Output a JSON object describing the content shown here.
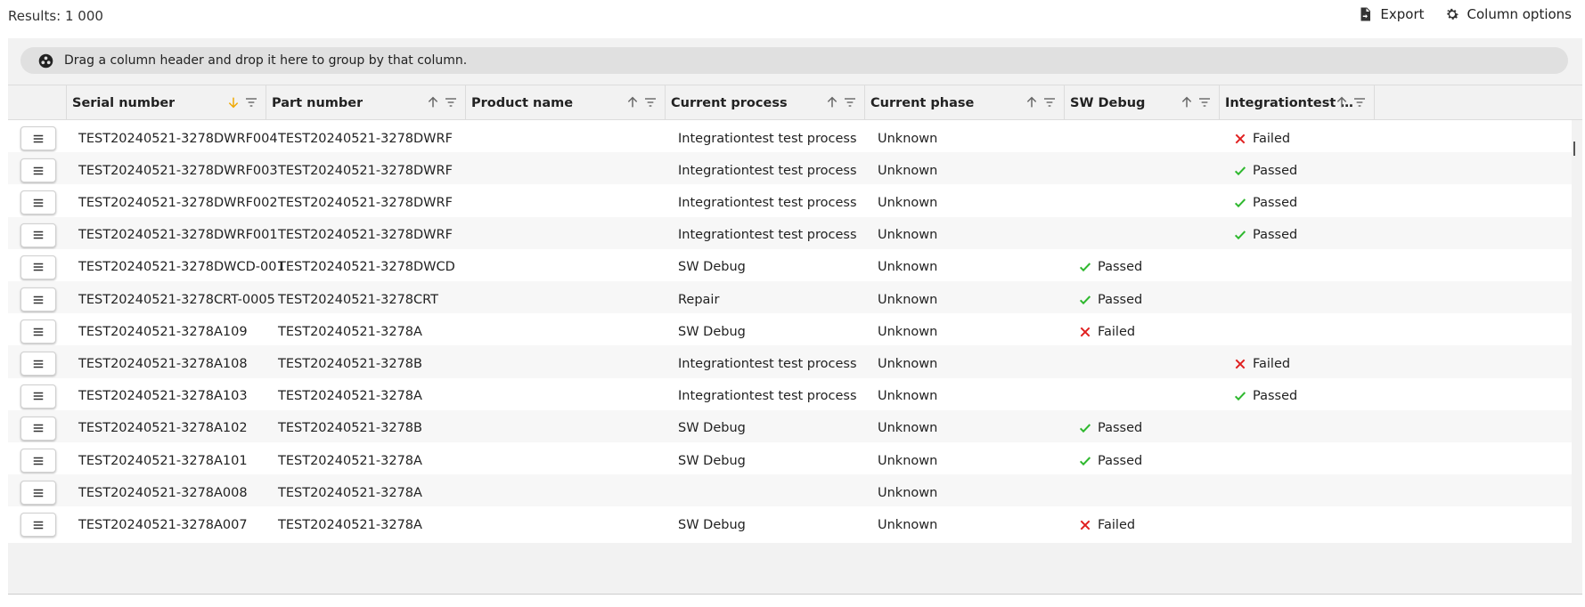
{
  "results_label": "Results: 1 000",
  "actions": {
    "export": "Export",
    "column_options": "Column options"
  },
  "group_bar": {
    "text": "Drag a column header and drop it here to group by that column."
  },
  "columns": [
    {
      "key": "serial",
      "label": "Serial number",
      "sort": "desc-active"
    },
    {
      "key": "part",
      "label": "Part number",
      "sort": "asc"
    },
    {
      "key": "product",
      "label": "Product name",
      "sort": "asc"
    },
    {
      "key": "process",
      "label": "Current process",
      "sort": "asc"
    },
    {
      "key": "phase",
      "label": "Current phase",
      "sort": "asc"
    },
    {
      "key": "swdebug",
      "label": "SW Debug",
      "sort": "asc"
    },
    {
      "key": "integ",
      "label": "Integrationtest te...",
      "sort": "asc"
    }
  ],
  "rows": [
    {
      "serial": "TEST20240521-3278DWRF004",
      "part": "TEST20240521-3278DWRF",
      "product": "",
      "process": "Integrationtest test process",
      "phase": "Unknown",
      "swdebug": "",
      "integ": "Failed"
    },
    {
      "serial": "TEST20240521-3278DWRF003",
      "part": "TEST20240521-3278DWRF",
      "product": "",
      "process": "Integrationtest test process",
      "phase": "Unknown",
      "swdebug": "",
      "integ": "Passed"
    },
    {
      "serial": "TEST20240521-3278DWRF002",
      "part": "TEST20240521-3278DWRF",
      "product": "",
      "process": "Integrationtest test process",
      "phase": "Unknown",
      "swdebug": "",
      "integ": "Passed"
    },
    {
      "serial": "TEST20240521-3278DWRF001",
      "part": "TEST20240521-3278DWRF",
      "product": "",
      "process": "Integrationtest test process",
      "phase": "Unknown",
      "swdebug": "",
      "integ": "Passed"
    },
    {
      "serial": "TEST20240521-3278DWCD-001",
      "part": "TEST20240521-3278DWCD",
      "product": "",
      "process": "SW Debug",
      "phase": "Unknown",
      "swdebug": "Passed",
      "integ": ""
    },
    {
      "serial": "TEST20240521-3278CRT-0005",
      "part": "TEST20240521-3278CRT",
      "product": "",
      "process": "Repair",
      "phase": "Unknown",
      "swdebug": "Passed",
      "integ": ""
    },
    {
      "serial": "TEST20240521-3278A109",
      "part": "TEST20240521-3278A",
      "product": "",
      "process": "SW Debug",
      "phase": "Unknown",
      "swdebug": "Failed",
      "integ": ""
    },
    {
      "serial": "TEST20240521-3278A108",
      "part": "TEST20240521-3278B",
      "product": "",
      "process": "Integrationtest test process",
      "phase": "Unknown",
      "swdebug": "",
      "integ": "Failed"
    },
    {
      "serial": "TEST20240521-3278A103",
      "part": "TEST20240521-3278A",
      "product": "",
      "process": "Integrationtest test process",
      "phase": "Unknown",
      "swdebug": "",
      "integ": "Passed"
    },
    {
      "serial": "TEST20240521-3278A102",
      "part": "TEST20240521-3278B",
      "product": "",
      "process": "SW Debug",
      "phase": "Unknown",
      "swdebug": "Passed",
      "integ": ""
    },
    {
      "serial": "TEST20240521-3278A101",
      "part": "TEST20240521-3278A",
      "product": "",
      "process": "SW Debug",
      "phase": "Unknown",
      "swdebug": "Passed",
      "integ": ""
    },
    {
      "serial": "TEST20240521-3278A008",
      "part": "TEST20240521-3278A",
      "product": "",
      "process": "",
      "phase": "Unknown",
      "swdebug": "",
      "integ": ""
    },
    {
      "serial": "TEST20240521-3278A007",
      "part": "TEST20240521-3278A",
      "product": "",
      "process": "SW Debug",
      "phase": "Unknown",
      "swdebug": "Failed",
      "integ": ""
    }
  ],
  "colors": {
    "pass": "#2eb82e",
    "fail": "#e02020",
    "sort_active": "#f0a800",
    "icon": "#666666"
  },
  "icons": {
    "export": "file-export-icon",
    "column_options": "gear-icon",
    "group": "group-icon",
    "row_menu": "hamburger-menu-icon",
    "sort_up": "arrow-up-icon",
    "sort_down": "arrow-down-icon",
    "filter": "filter-icon",
    "pass": "check-icon",
    "fail": "x-icon"
  }
}
